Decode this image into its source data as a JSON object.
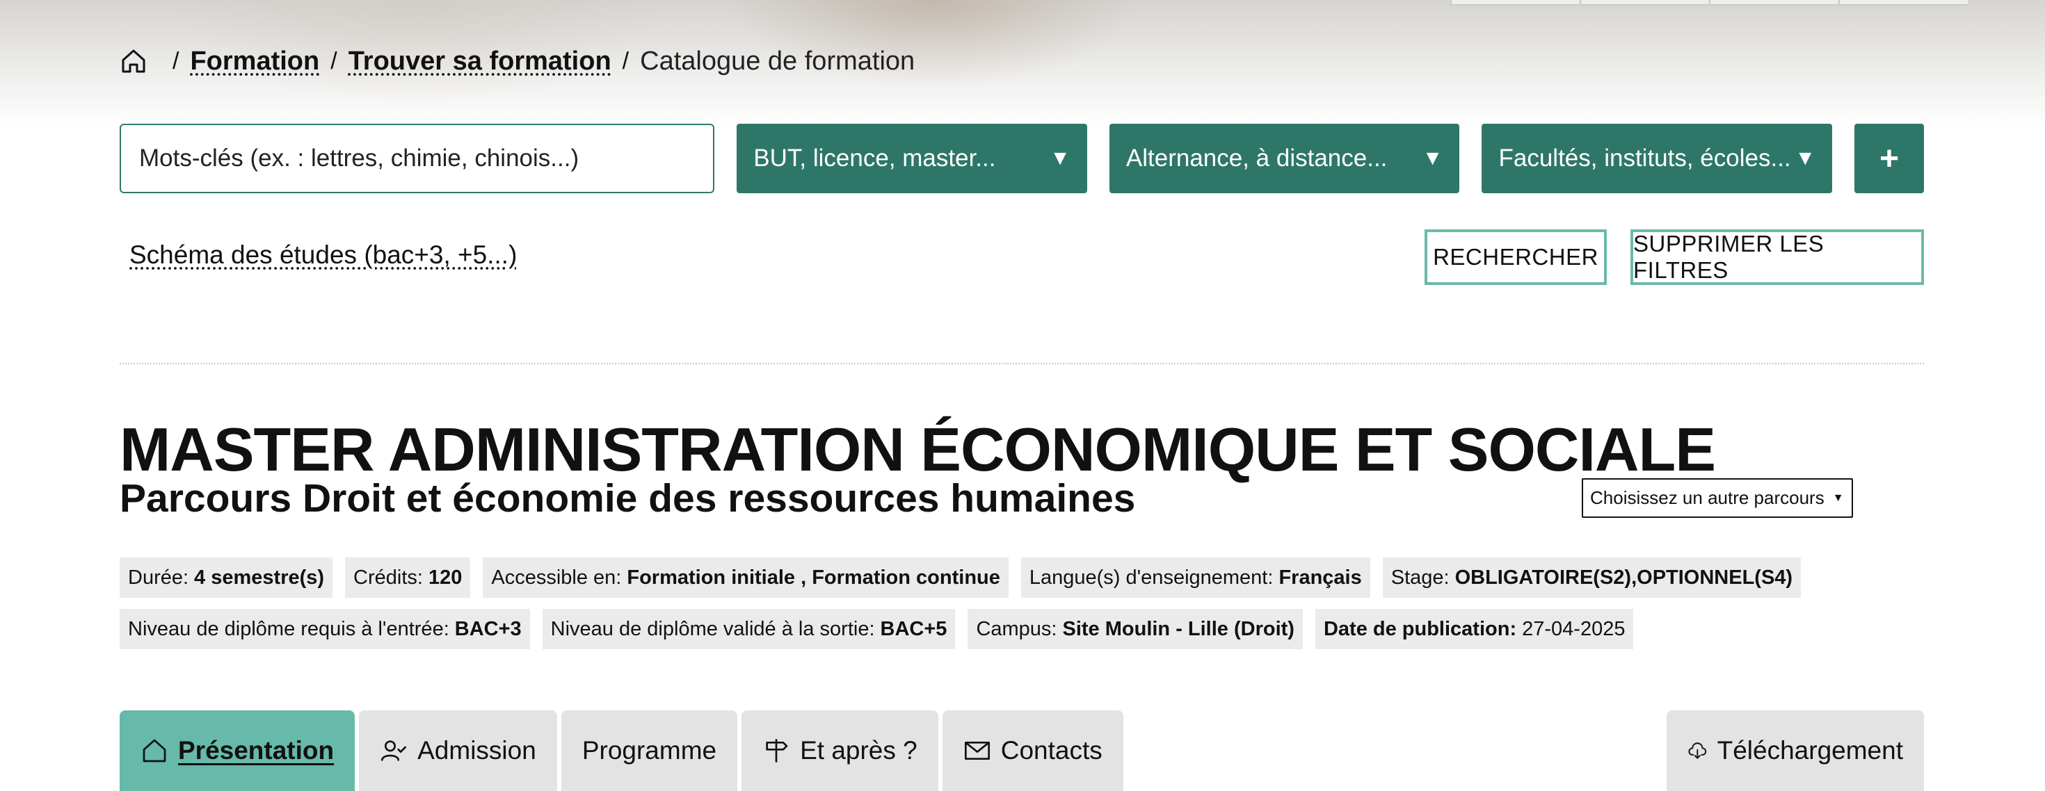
{
  "breadcrumb": {
    "home_icon": "home-icon",
    "items": [
      "Formation",
      "Trouver sa formation"
    ],
    "current": "Catalogue de formation"
  },
  "search": {
    "keywords_placeholder": "Mots-clés (ex. : lettres, chimie, chinois...)",
    "filters": [
      {
        "label": "BUT, licence, master...",
        "icon": "caret-down-icon"
      },
      {
        "label": "Alternance, à distance...",
        "icon": "caret-down-icon"
      },
      {
        "label": "Facultés, instituts, écoles...",
        "icon": "caret-down-icon"
      }
    ],
    "more_label": "+",
    "schema_link": "Schéma des études (bac+3, +5...)",
    "search_button": "RECHERCHER",
    "clear_button": "SUPPRIMER LES FILTRES"
  },
  "program": {
    "title": "MASTER ADMINISTRATION ÉCONOMIQUE ET SOCIALE",
    "subtitle": "Parcours Droit et économie des ressources humaines",
    "parcours_select": "Choisissez un autre parcours"
  },
  "badges_row1": [
    {
      "label": "Durée:",
      "value": "4 semestre(s)"
    },
    {
      "label": "Crédits:",
      "value": "120"
    },
    {
      "label": "Accessible en:",
      "value": "Formation initiale , Formation continue"
    },
    {
      "label": "Langue(s) d'enseignement:",
      "value": "Français"
    },
    {
      "label": "Stage:",
      "value": "OBLIGATOIRE(S2),OPTIONNEL(S4)"
    }
  ],
  "badges_row2": [
    {
      "label": "Niveau de diplôme requis à l'entrée:",
      "value": "BAC+3"
    },
    {
      "label": "Niveau de diplôme validé à la sortie:",
      "value": "BAC+5"
    },
    {
      "label": "Campus:",
      "value": "Site Moulin - Lille (Droit)"
    }
  ],
  "publication": {
    "label": "Date de publication:",
    "value": "27-04-2025"
  },
  "tabs": [
    {
      "label": "Présentation",
      "icon": "home-icon",
      "active": true
    },
    {
      "label": "Admission",
      "icon": "user-check-icon"
    },
    {
      "label": "Programme",
      "icon": ""
    },
    {
      "label": "Et après ?",
      "icon": "signpost-icon"
    },
    {
      "label": "Contacts",
      "icon": "envelope-icon"
    }
  ],
  "download_tab": {
    "label": "Téléchargement",
    "icon": "cloud-download-icon"
  },
  "colors": {
    "primary": "#2e7768",
    "accent": "#67b9aa",
    "badge_bg": "#ebebeb",
    "tab_bg": "#e3e3e3"
  }
}
